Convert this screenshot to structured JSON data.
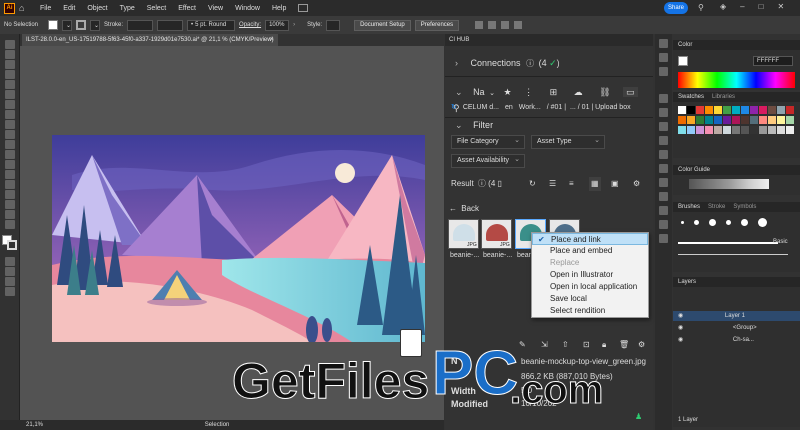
{
  "menu": [
    "File",
    "Edit",
    "Object",
    "Type",
    "Select",
    "Effect",
    "View",
    "Window",
    "Help"
  ],
  "share_label": "Share",
  "control": {
    "selection": "No Selection",
    "stroke_label": "Stroke:",
    "brush": "5 pt. Round",
    "opacity_label": "Opacity:",
    "opacity": "100%",
    "style_label": "Style:",
    "doc_setup": "Document Setup",
    "preferences": "Preferences"
  },
  "doc_tab": "ILST-28.0.0-en_US-17519788-5f63-45f0-a337-1929d01e7530.ai* @ 21,1 % (CMYK/Preview)",
  "status": {
    "zoom": "21,1%",
    "mode": "Selection"
  },
  "ch": {
    "tab": "CI HUB",
    "connections": "Connections",
    "connections_count": "(4",
    "name_label": "Na",
    "breadcrumb": [
      "CELUM d...",
      "en",
      "Work...",
      "/ #01 |",
      "... / 01 | Upload box"
    ],
    "filter": "Filter",
    "file_category": "File Category",
    "asset_type": "Asset Type",
    "asset_availability": "Asset Availability",
    "result": "Result",
    "result_count": "(4",
    "back": "Back",
    "thumbs": [
      {
        "label": "beanie-...",
        "ext": "JPG",
        "color": "#cfdfe8"
      },
      {
        "label": "beanie-...",
        "ext": "JPG",
        "color": "#b44a45"
      },
      {
        "label": "beani",
        "ext": "",
        "color": "#3a8f8a"
      },
      {
        "label": "",
        "ext": "",
        "color": "#4f6f8a"
      }
    ],
    "details": {
      "filename": "beanie-mockup-top-view_green.jpg",
      "size": "866.2 KB (887,010 Bytes)",
      "width_label": "Width",
      "width_val": "5,0",
      "modified_label": "Modified",
      "modified_val": "10/10/202",
      "n_label": "N"
    }
  },
  "context_menu": [
    {
      "label": "Place and link",
      "checked": true,
      "disabled": false
    },
    {
      "label": "Place and embed",
      "checked": false,
      "disabled": false
    },
    {
      "label": "Replace",
      "checked": false,
      "disabled": true
    },
    {
      "label": "Open in Illustrator",
      "checked": false,
      "disabled": false
    },
    {
      "label": "Open in local application",
      "checked": false,
      "disabled": false
    },
    {
      "label": "Save local",
      "checked": false,
      "disabled": false
    },
    {
      "label": "Select rendition",
      "checked": false,
      "disabled": false
    }
  ],
  "right_panels": {
    "color": "Color",
    "hex": "FFFFFF",
    "swatches": "Swatches",
    "libraries": "Libraries",
    "color_guide": "Color Guide",
    "brushes": "Brushes",
    "stroke": "Stroke",
    "symbols": "Symbols",
    "basic": "Basic",
    "layers": "Layers",
    "layer_rows": [
      "Layer 1",
      "<Group>",
      "Ch-sa..."
    ],
    "layers_count": "1 Layer"
  },
  "watermark": {
    "a": "GetFiles",
    "b": "PC",
    "c": ".com"
  },
  "colors": {
    "accent": "#1473e6",
    "check": "#2e7d32",
    "layer_sel": "#2d4a6e"
  }
}
